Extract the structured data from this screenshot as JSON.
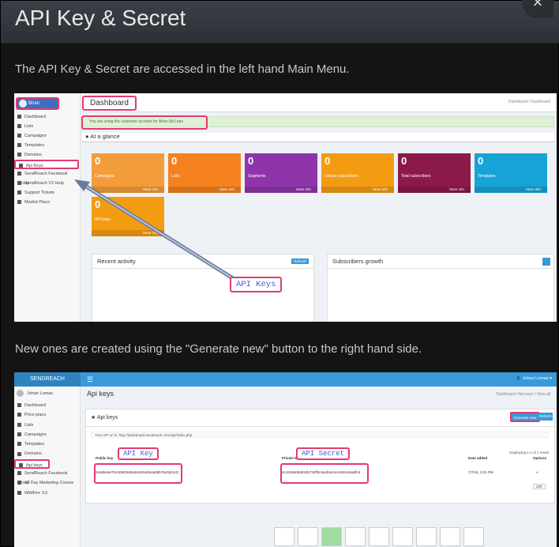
{
  "header": {
    "title": "API Key & Secret",
    "close_label": "×"
  },
  "intro_text": "The API Key & Secret are accessed in the left hand Main Menu.",
  "intro2_text": "New ones are created using the \"Generate new\" button to the right hand side.",
  "shot1": {
    "user_name": "Brian McLean",
    "nav": [
      {
        "label": "Dashboard",
        "icon": "dashboard-icon"
      },
      {
        "label": "Lists",
        "icon": "list-icon"
      },
      {
        "label": "Campaigns",
        "icon": "envelope-icon"
      },
      {
        "label": "Templates",
        "icon": "text-icon"
      },
      {
        "label": "Domains",
        "icon": "globe-icon"
      },
      {
        "label": "Api Keys",
        "icon": "star-icon"
      },
      {
        "label": "SendReach Facebook Group",
        "icon": "facebook-icon"
      },
      {
        "label": "SendReach V3 Help",
        "icon": "help-icon"
      },
      {
        "label": "Support Tickets",
        "icon": "ticket-icon"
      },
      {
        "label": "Market Place",
        "icon": "market-icon"
      }
    ],
    "page_title": "Dashboard",
    "breadcrumb": "Dashboard / Dashboard",
    "alert": "You are using the customer account for Brian McLean",
    "at_a_glance": "At a glance",
    "tiles": [
      {
        "num": "0",
        "label": "Campaigns",
        "color": "#f39c3a"
      },
      {
        "num": "0",
        "label": "Lists",
        "color": "#f5821f"
      },
      {
        "num": "0",
        "label": "Segments",
        "color": "#8e35a9"
      },
      {
        "num": "0",
        "label": "Unique subscribers",
        "color": "#f39c12"
      },
      {
        "num": "0",
        "label": "Total subscribers",
        "color": "#8b1a4a"
      },
      {
        "num": "0",
        "label": "Templates",
        "color": "#17a3d6"
      },
      {
        "num": "0",
        "label": "API keys",
        "color": "#f39c12"
      }
    ],
    "more_info": "More info",
    "recent_activity": "Recent activity",
    "refresh": "Refresh",
    "subscribers_growth": "Subscribers growth",
    "api_callout": "API Keys"
  },
  "shot2": {
    "brand": "SENDREACH",
    "top_user": "Johan Lomas",
    "side_user": "Johan Lomas",
    "nav": [
      {
        "label": "Dashboard"
      },
      {
        "label": "Price plans"
      },
      {
        "label": "Lists"
      },
      {
        "label": "Campaigns"
      },
      {
        "label": "Templates"
      },
      {
        "label": "Domains"
      },
      {
        "label": "Api keys"
      },
      {
        "label": "SendReach Facebook Group"
      },
      {
        "label": "42 Day Marketing Course"
      },
      {
        "label": "WildFire 3.0"
      }
    ],
    "page_title": "Api keys",
    "breadcrumb": "Dashboard / Api keys / View all",
    "panel_title": "Api keys",
    "generate_btn": "Generate new",
    "refresh_btn": "Refresh",
    "api_url": "Your API url is: http://dashboard.sendreach.com/api/index.php",
    "displaying": "Displaying 1-1 of 1 result.",
    "columns": {
      "public": "Public key",
      "private": "Private key",
      "date": "Date added",
      "options": "Options"
    },
    "row": {
      "public": "2a3d5e8e7044090366ba84d26d4ba8d8b78e3d21d2",
      "private": "4c1919606dd18b732ff5cda4fa2e1e1926c3eadfc8",
      "date": "7/7/15, 3:31 PM",
      "per_page": "100"
    },
    "api_key_label": "API Key",
    "api_secret_label": "API Secret"
  }
}
